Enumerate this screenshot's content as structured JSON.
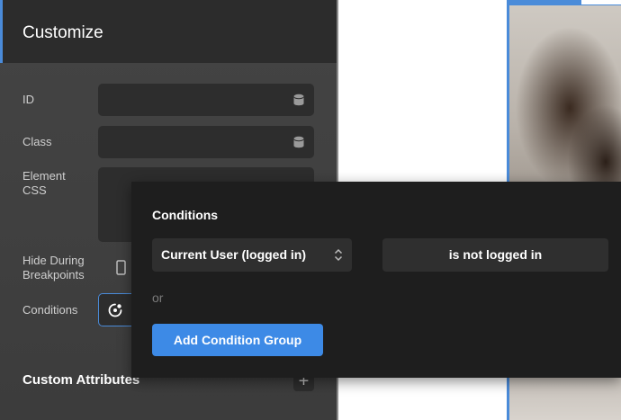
{
  "panel": {
    "title": "Customize",
    "fields": {
      "id_label": "ID",
      "class_label": "Class",
      "element_css_label_line1": "Element",
      "element_css_label_line2": "CSS",
      "hide_label_line1": "Hide During",
      "hide_label_line2": "Breakpoints",
      "conditions_label": "Conditions"
    },
    "custom_attributes_label": "Custom Attributes",
    "add_attribute_symbol": "+"
  },
  "popup": {
    "title": "Conditions",
    "condition_select_value": "Current User (logged in)",
    "condition_value": "is not logged in",
    "or_label": "or",
    "add_group_label": "Add Condition Group"
  },
  "colors": {
    "accent": "#4a8bd9",
    "button_blue": "#3d8ae6",
    "panel_bg": "#444444",
    "popup_bg": "#1e1e1e"
  },
  "icons": {
    "database": "database-icon",
    "device": "mobile-device-icon",
    "conditions": "conditions-icon",
    "select_chevrons": "chevron-up-down-icon",
    "plus": "plus-icon"
  }
}
